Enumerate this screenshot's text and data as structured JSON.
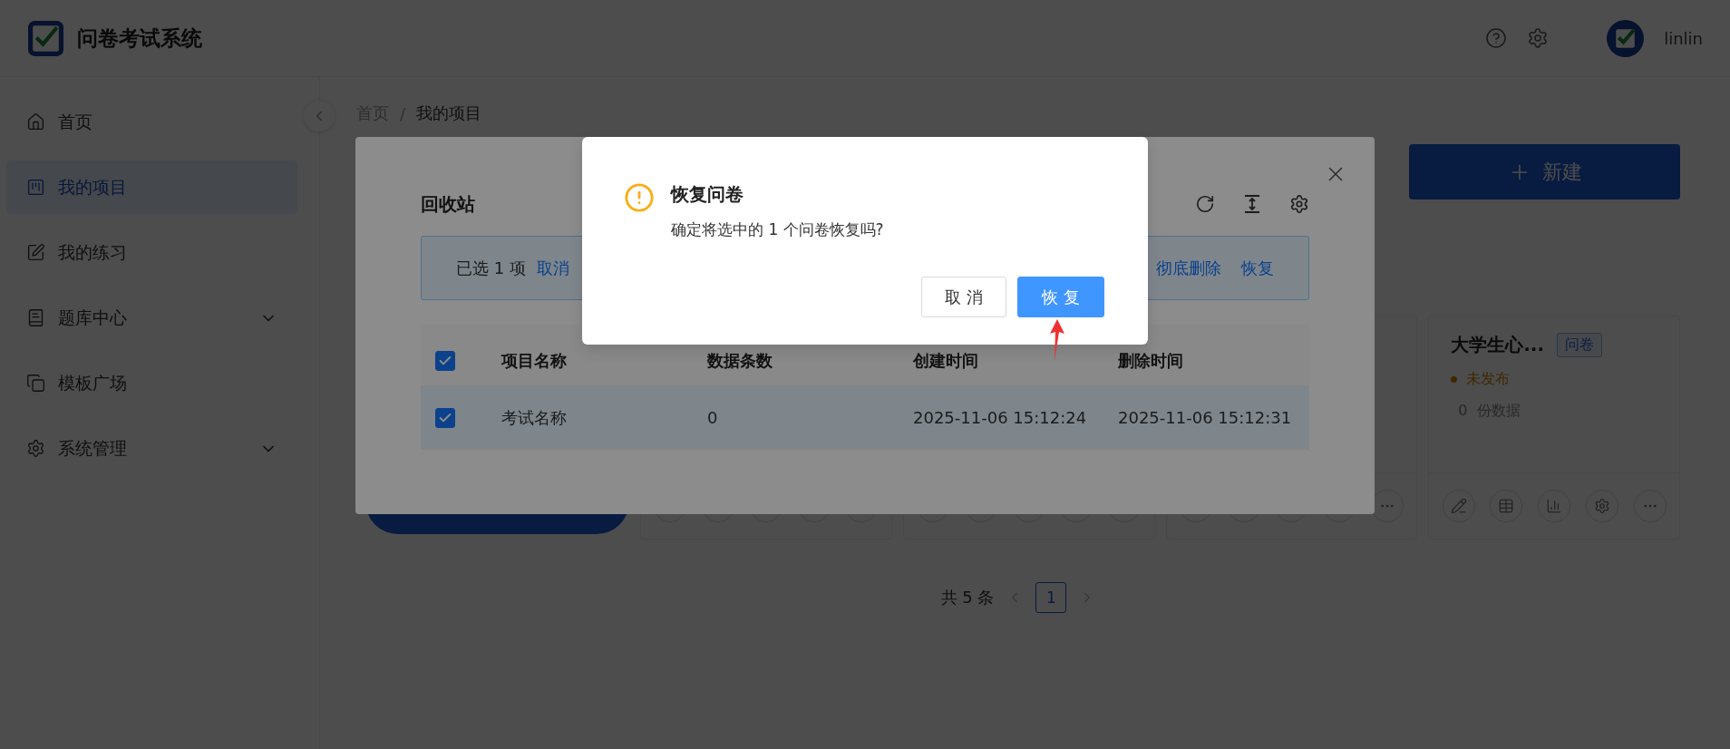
{
  "app": {
    "title": "问卷考试系统",
    "user": "linlin"
  },
  "sidebar": {
    "items": [
      {
        "label": "首页",
        "selected": false
      },
      {
        "label": "我的项目",
        "selected": true
      },
      {
        "label": "我的练习",
        "selected": false
      },
      {
        "label": "题库中心",
        "selected": false,
        "expanded": false
      },
      {
        "label": "模板广场",
        "selected": false
      },
      {
        "label": "系统管理",
        "selected": false,
        "expanded": false
      }
    ]
  },
  "breadcrumb": {
    "items": [
      "首页",
      "我的项目"
    ],
    "separator": "/"
  },
  "new_button": "新建",
  "cards": [
    {
      "kind": "new-card"
    },
    {
      "kind": "project"
    },
    {
      "kind": "project"
    },
    {
      "kind": "project"
    },
    {
      "kind": "project",
      "title": "大学生心...",
      "tag": "问卷",
      "status": "未发布",
      "count": "0",
      "count_label": "份数据"
    }
  ],
  "pagination": {
    "total": "共 5 条",
    "pages": [
      {
        "label": "1",
        "selected": true
      }
    ]
  },
  "recycle_bin": {
    "title": "回收站",
    "selection_text": "已选 1 项",
    "cancel": "取消",
    "actions": [
      "彻底删除",
      "恢复"
    ],
    "all_selected": true,
    "columns": [
      "项目名称",
      "数据条数",
      "创建时间",
      "删除时间"
    ],
    "rows": [
      {
        "selected": true,
        "cells": [
          "考试名称",
          "0",
          "2025-11-06 15:12:24",
          "2025-11-06 15:12:31"
        ]
      }
    ]
  },
  "confirm": {
    "title": "恢复问卷",
    "message": "确定将选中的 1 个问卷恢复吗?",
    "buttons": [
      {
        "label": "取 消",
        "kind": "default"
      },
      {
        "label": "恢 复",
        "kind": "primary"
      }
    ]
  }
}
